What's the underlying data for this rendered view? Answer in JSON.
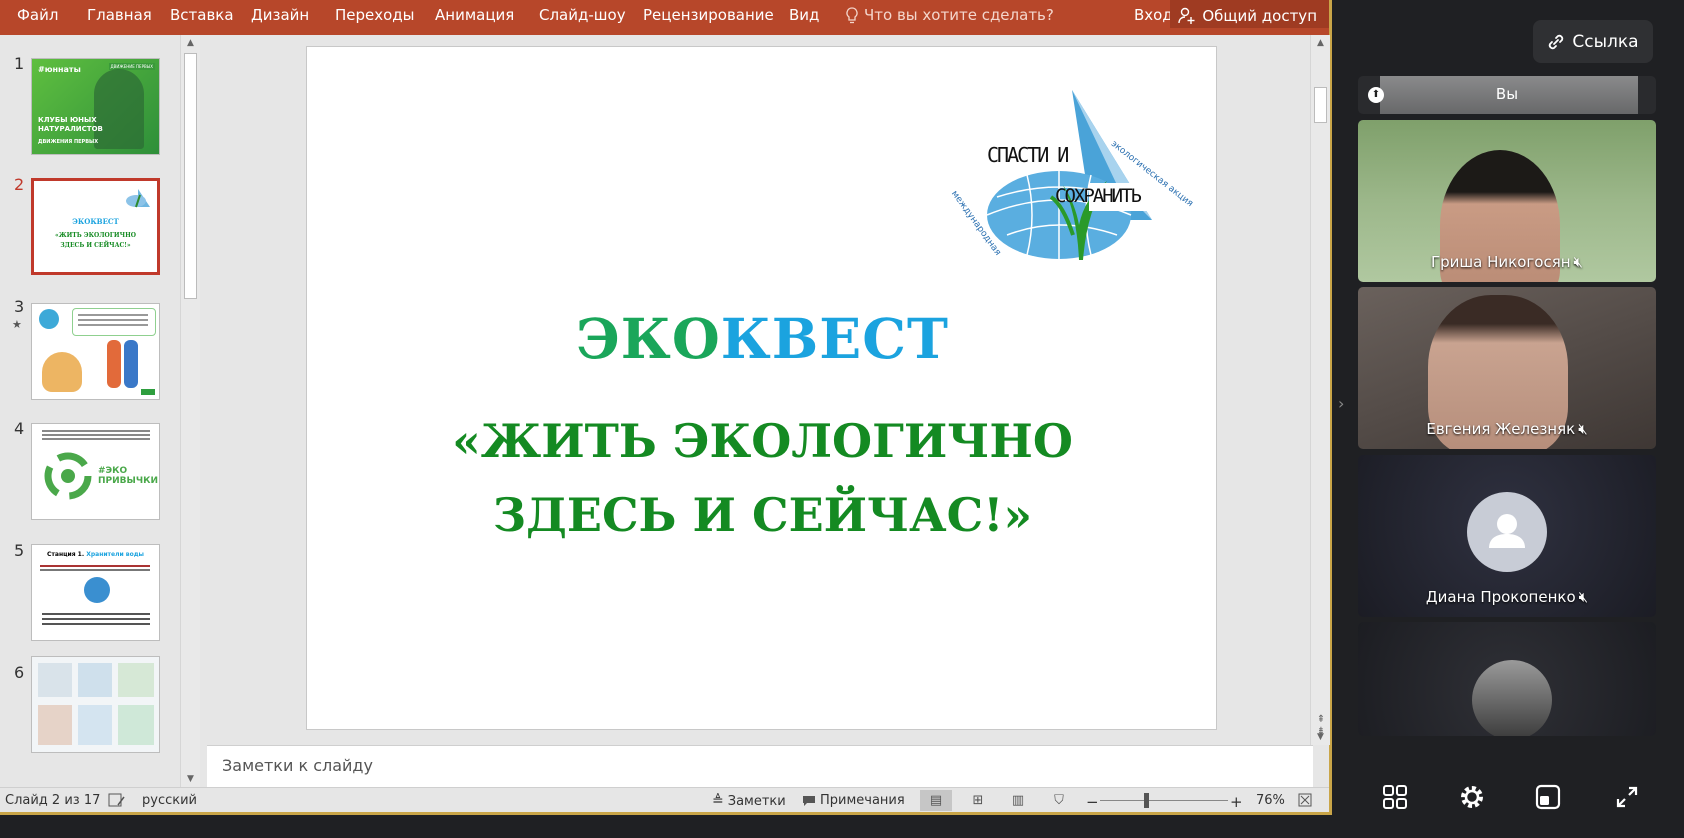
{
  "ribbon": {
    "menu": [
      "Файл",
      "Главная",
      "Вставка",
      "Дизайн",
      "Переходы",
      "Анимация",
      "Слайд-шоу",
      "Рецензирование",
      "Вид"
    ],
    "tell_me": "Что вы хотите сделать?",
    "login": "Вход",
    "share": "Общий доступ"
  },
  "thumbnails": {
    "numbers": [
      "1",
      "2",
      "3",
      "4",
      "5",
      "6"
    ],
    "active_index": 2,
    "slide1": {
      "brand": "#юннаты",
      "tag": "ДВИЖЕНИЕ ПЕРВЫХ",
      "title": "КЛУБЫ ЮНЫХ НАТУРАЛИСТОВ",
      "subtitle": "ДВИЖЕНИЯ ПЕРВЫХ"
    },
    "slide2": {
      "line1": "ЭКОКВЕСТ",
      "line2": "«ЖИТЬ ЭКОЛОГИЧНО",
      "line3": "ЗДЕСЬ И СЕЙЧАС!»"
    },
    "slide4": {
      "tag": "#ЭКО",
      "label": "ПРИВЫЧКИ"
    },
    "slide5": {
      "title_a": "Станция 1.",
      "title_b": "Хранители воды"
    }
  },
  "slide": {
    "logo_line1": "СПАСТИ И",
    "logo_line2": "СОХРАНИТЬ",
    "logo_arc_top": "экологическая акция",
    "logo_arc_bottom": "международная",
    "title_green": "ЭКО",
    "title_blue": "КВЕСТ",
    "line1": "«ЖИТЬ ЭКОЛОГИЧНО",
    "line2": "ЗДЕСЬ И СЕЙЧАС!»"
  },
  "notes_placeholder": "Заметки к слайду",
  "status": {
    "slide_info": "Слайд 2 из 17",
    "language": "русский",
    "notes": "Заметки",
    "comments": "Примечания",
    "zoom": "76%"
  },
  "meeting": {
    "link_label": "Ссылка",
    "self_label": "Вы",
    "participants": [
      {
        "name": "Гриша Никогосян",
        "muted": true
      },
      {
        "name": "Евгения Железняк",
        "muted": true
      },
      {
        "name": "Диана Прокопенко",
        "muted": true
      }
    ]
  },
  "colors": {
    "ribbon": "#b7472a",
    "title_green": "#1aa65a",
    "title_blue": "#1ba3df",
    "quote_green": "#148a22",
    "active_thumb": "#c0392b"
  }
}
